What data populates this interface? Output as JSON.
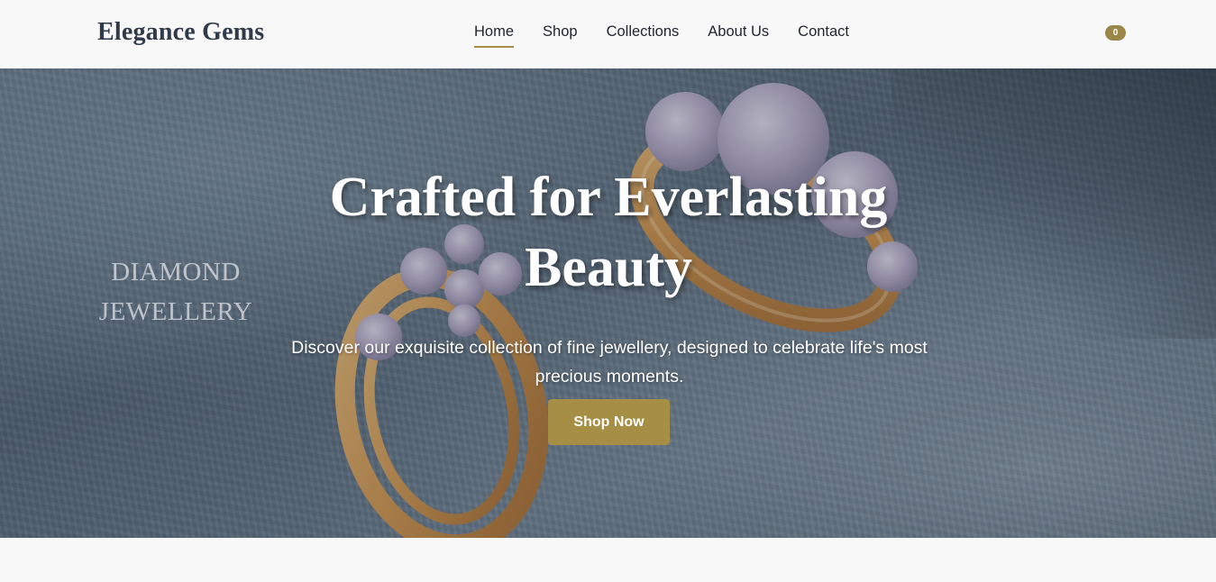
{
  "brand": {
    "name": "Elegance Gems",
    "accent_color": "#a68f44"
  },
  "nav": {
    "items": [
      {
        "label": "Home",
        "active": true
      },
      {
        "label": "Shop",
        "active": false
      },
      {
        "label": "Collections",
        "active": false
      },
      {
        "label": "About Us",
        "active": false
      },
      {
        "label": "Contact",
        "active": false
      }
    ]
  },
  "cart": {
    "count": "0",
    "icon": "cart-count-badge"
  },
  "hero": {
    "image_caption_line1": "DIAMOND",
    "image_caption_line2": "JEWELLERY",
    "title": "Crafted for Everlasting Beauty",
    "subtitle": "Discover our exquisite collection of fine jewellery, designed to celebrate life's most precious moments.",
    "cta_label": "Shop Now"
  }
}
